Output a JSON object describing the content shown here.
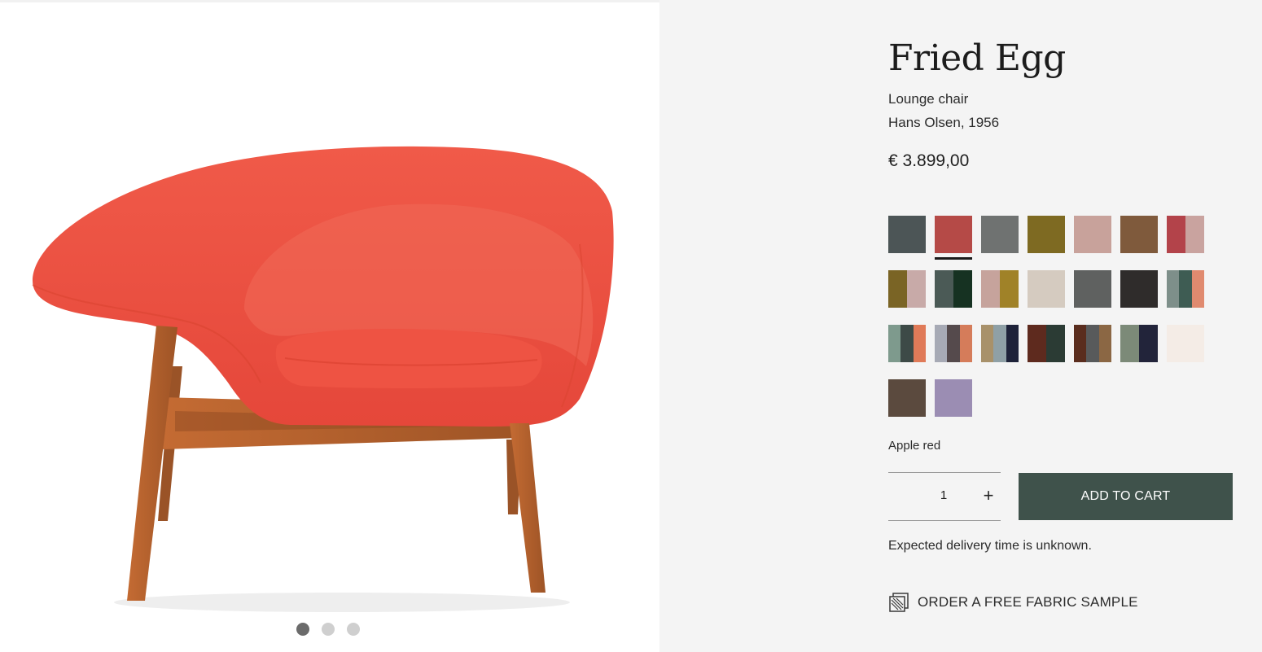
{
  "product": {
    "title": "Fried Egg",
    "type": "Lounge chair",
    "designer": "Hans Olsen, 1956",
    "price": "€ 3.899,00",
    "selected_color": "Apple red"
  },
  "gallery": {
    "slide_count": 3,
    "active_slide": 1,
    "next_icon": "chevron-right-icon"
  },
  "swatch_colors": {
    "row1": [
      "#4c5556",
      "#b54a47",
      "#6f7271",
      "#7e6a22",
      "#c8a29b",
      "#7f5a3c",
      "#b3434a+#c9a39f"
    ],
    "row2": [
      "#7a6425+#c8aaa8",
      "#4b5a56+#163222",
      "#c6a39c+#a08228",
      "#d5cbc0",
      "#5f6160",
      "#2f2c2b",
      "#7e8f8a+#3e5c53+#e08a6f"
    ],
    "row3": [
      "#7e9a8d+#3d4a47+#e07a58",
      "#a7aab5+#554a4c+#d57c5a",
      "#a8916a+#8fa0a6+#1e2239",
      "#5e2a1e+#2b3b34",
      "#5a2d1e+#585a5b+#8b6744",
      "#7c8a78+#22243a",
      "#f4ece6"
    ],
    "row4": [
      "#5b4a3e",
      "#9b8db3"
    ]
  },
  "quantity": {
    "value": "1",
    "increment_label": "+"
  },
  "cart": {
    "add_label": "ADD TO CART"
  },
  "delivery": {
    "text": "Expected delivery time is unknown."
  },
  "sample": {
    "label": "ORDER A FREE FABRIC SAMPLE",
    "icon": "fabric-sample-icon"
  },
  "colors": {
    "accent": "#3f524b",
    "chair": "#ec4d3e",
    "wood": "#b0602d"
  }
}
